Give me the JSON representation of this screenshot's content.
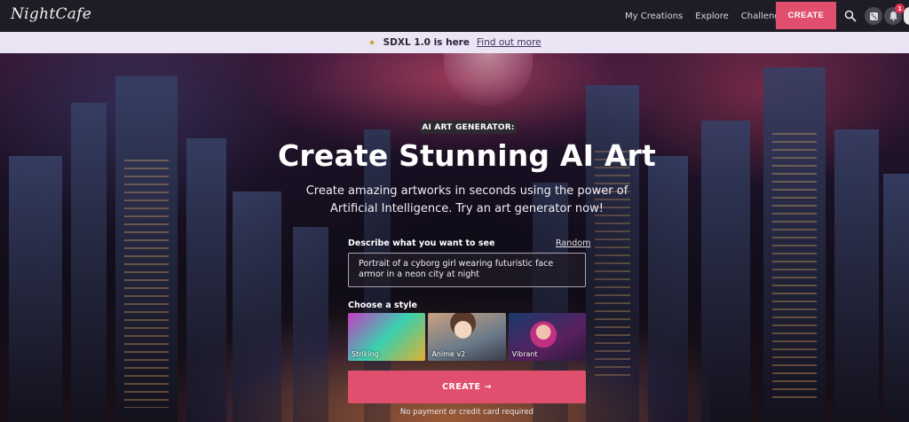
{
  "app": {
    "logo_text": "NightCafe"
  },
  "nav": {
    "links": [
      "My Creations",
      "Explore",
      "Challenges"
    ],
    "create_label": "CREATE",
    "notification_count": "1"
  },
  "announcement": {
    "sparkle_icon": "sparkle-icon",
    "text": "SDXL 1.0 is here",
    "link": "Find out more"
  },
  "hero": {
    "tag": "AI ART GENERATOR:",
    "title": "Create Stunning AI Art",
    "subtitle": "Create amazing artworks in seconds using the power of Artificial Intelligence. Try an art generator now!"
  },
  "form": {
    "describe_label": "Describe what you want to see",
    "random_label": "Random",
    "prompt_value": "Portrait of a cyborg girl wearing futuristic face armor in a neon city at night",
    "style_label": "Choose a style",
    "styles": [
      {
        "name": "Striking",
        "selected": true
      },
      {
        "name": "Anime v2",
        "selected": false
      },
      {
        "name": "Vibrant",
        "selected": false
      }
    ],
    "create_label": "CREATE",
    "create_arrow": "→",
    "footnote": "No payment or credit card required"
  },
  "colors": {
    "accent": "#e0506e",
    "nav_bg": "#1e1c25",
    "announce_bg": "#ebe4f4",
    "selected_outline": "#4aa8e8"
  }
}
